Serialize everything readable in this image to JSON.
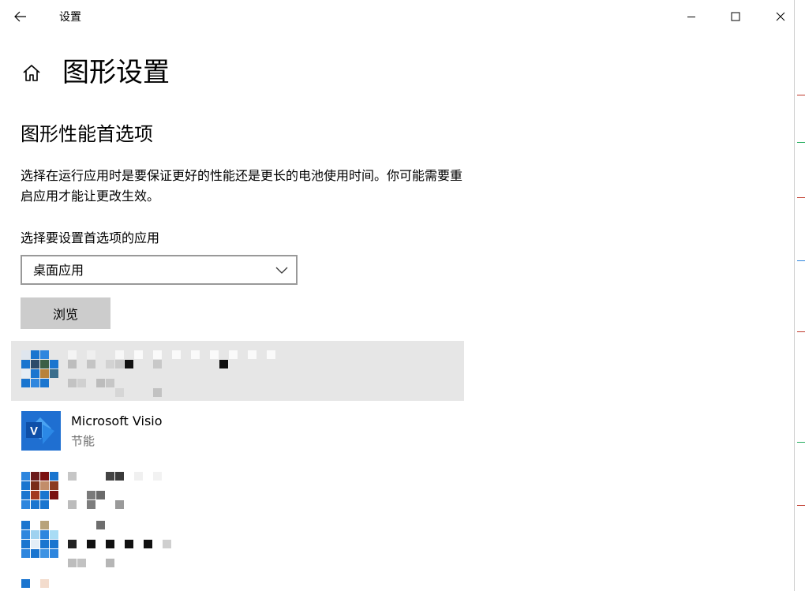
{
  "window": {
    "title": "设置",
    "controls": {
      "back_icon": "arrow-left-icon",
      "minimize_icon": "minimize-icon",
      "maximize_icon": "maximize-icon",
      "close_icon": "close-icon"
    }
  },
  "header": {
    "home_icon": "home-icon",
    "title": "图形设置"
  },
  "section": {
    "title": "图形性能首选项",
    "description": "选择在运行应用时是要保证更好的性能还是更长的电池使用时间。你可能需要重启应用才能让更改生效。"
  },
  "app_select": {
    "label": "选择要设置首选项的应用",
    "selected": "桌面应用",
    "browse_label": "浏览"
  },
  "apps": [
    {
      "name": "",
      "preference": "",
      "obscured": true,
      "selected": true
    },
    {
      "name": "Microsoft Visio",
      "preference": "节能",
      "icon": "visio-icon",
      "obscured": false,
      "selected": false
    },
    {
      "name": "",
      "preference": "",
      "obscured": true,
      "selected": false
    },
    {
      "name": "",
      "preference": "",
      "obscured": true,
      "selected": false
    }
  ],
  "colors": {
    "selected_row": "#e6e6e6",
    "button_bg": "#cccccc",
    "visio_blue": "#1f6fd1",
    "secondary_text": "#6d6d6d"
  }
}
